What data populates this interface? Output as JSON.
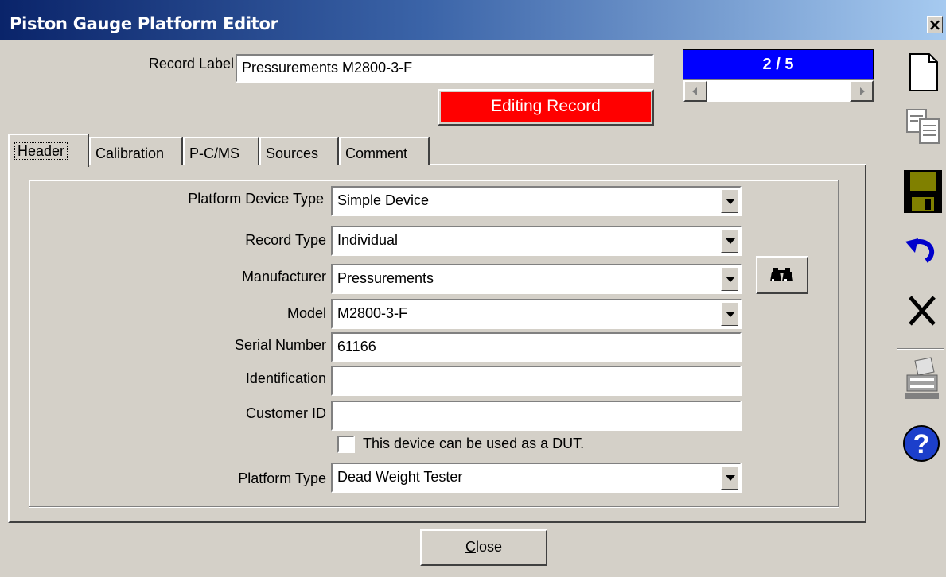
{
  "window": {
    "title": "Piston Gauge Platform Editor",
    "close_glyph": "×"
  },
  "record": {
    "label_caption": "Record Label",
    "label_value": "Pressurements M2800-3-F"
  },
  "status": {
    "text": "Editing Record",
    "color": "#ff0000"
  },
  "navigator": {
    "position": "2 / 5",
    "color": "#0000ff"
  },
  "tabs": [
    {
      "label": "Header",
      "active": true
    },
    {
      "label": "Calibration",
      "active": false
    },
    {
      "label": "P-C/MS",
      "active": false
    },
    {
      "label": "Sources",
      "active": false
    },
    {
      "label": "Comment",
      "active": false
    }
  ],
  "form": {
    "platform_device_type": {
      "label": "Platform Device Type",
      "value": "Simple Device"
    },
    "record_type": {
      "label": "Record Type",
      "value": "Individual"
    },
    "manufacturer": {
      "label": "Manufacturer",
      "value": "Pressurements"
    },
    "model": {
      "label": "Model",
      "value": "M2800-3-F"
    },
    "serial_number": {
      "label": "Serial Number",
      "value": "61166"
    },
    "identification": {
      "label": "Identification",
      "value": ""
    },
    "customer_id": {
      "label": "Customer ID",
      "value": ""
    },
    "dut_checkbox": {
      "label": "This device can be used as a DUT.",
      "checked": false
    },
    "platform_type": {
      "label": "Platform Type",
      "value": "Dead Weight Tester"
    }
  },
  "buttons": {
    "close": "Close",
    "close_mnemonic": "C",
    "close_rest": "lose"
  },
  "toolbar": [
    "new-record-icon",
    "copy-record-icon",
    "save-icon",
    "undo-icon",
    "delete-icon",
    "typewriter-icon",
    "help-icon"
  ]
}
